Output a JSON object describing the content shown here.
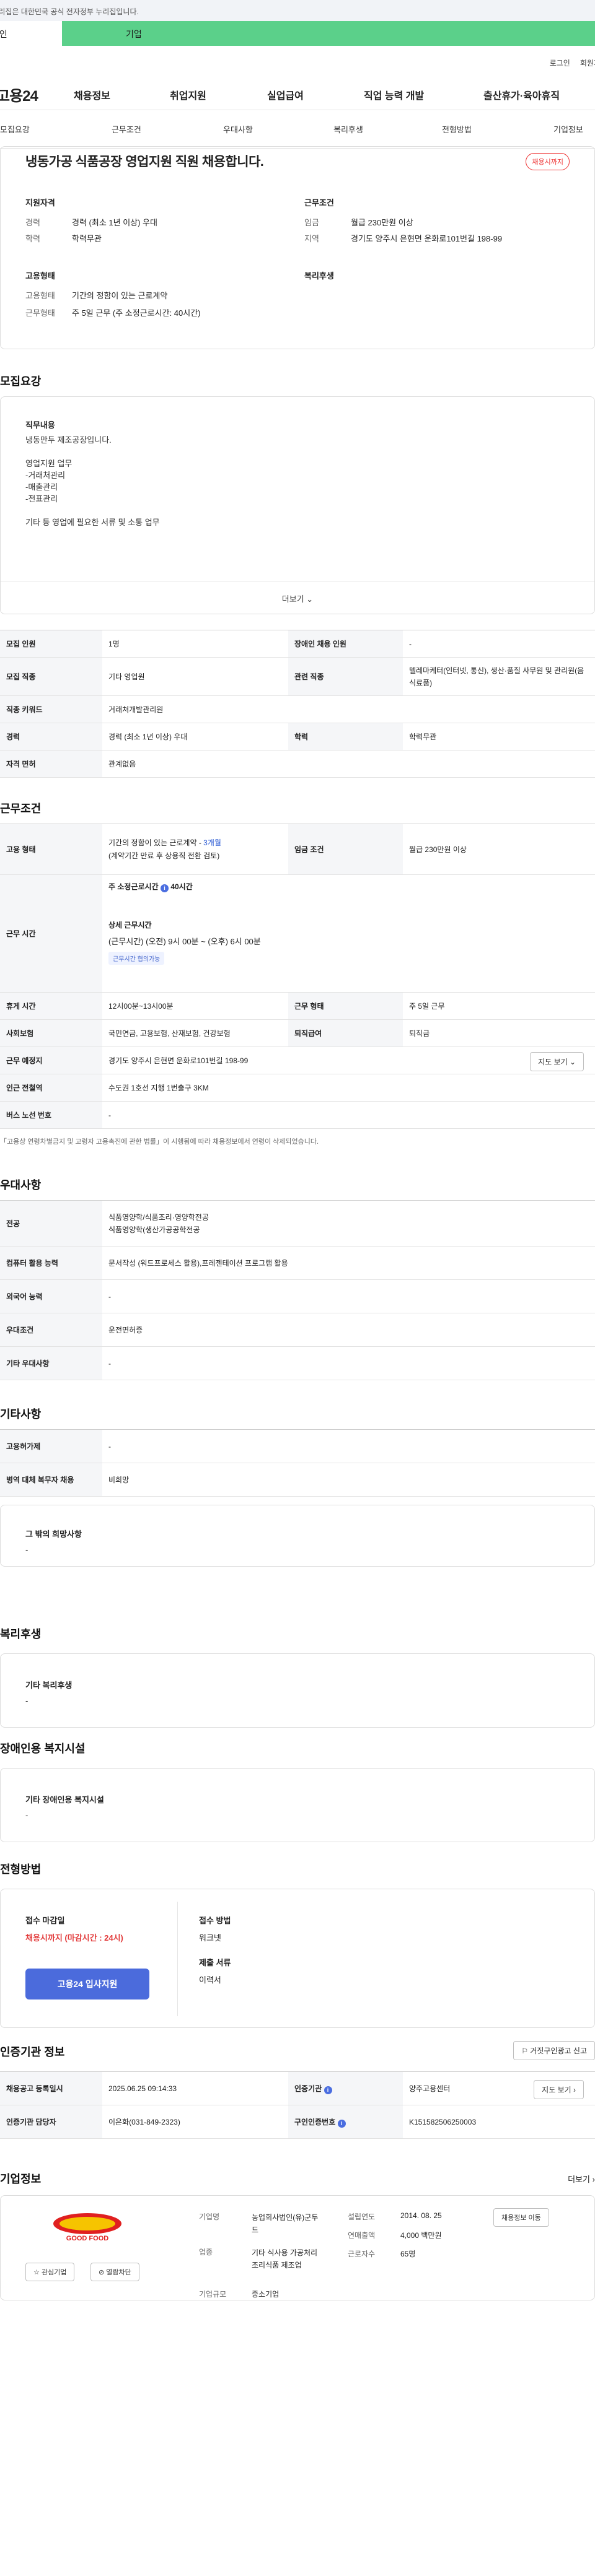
{
  "gov_bar": "이 누리집은 대한민국 공식 전자정부 누리집입니다.",
  "member_tabs": {
    "individual": "개인",
    "corporate": "기업"
  },
  "util": {
    "login": "로그인",
    "join": "회원가입"
  },
  "logo": "고용24",
  "gnb": [
    "채용정보",
    "취업지원",
    "실업급여",
    "직업 능력 개발",
    "출산휴가·육아휴직"
  ],
  "anchor_nav": [
    "모집요강",
    "근무조건",
    "우대사항",
    "복리후생",
    "전형방법",
    "기업정보"
  ],
  "summary": {
    "title": "냉동가공 식품공장 영업지원 직원 채용합니다.",
    "badge": "채용시까지",
    "qual": {
      "head": "지원자격",
      "career_k": "경력",
      "career_v": "경력 (최소 1년 이상) 우대",
      "edu_k": "학력",
      "edu_v": "학력무관"
    },
    "work": {
      "head": "근무조건",
      "wage_k": "임금",
      "wage_v": "월급 230만원 이상",
      "loc_k": "지역",
      "loc_v": "경기도 양주시 은현면 운화로101번길 198-99"
    },
    "employ": {
      "head": "고용형태",
      "type_k": "고용형태",
      "type_v": "기간의 정함이 있는 근로계약",
      "shape_k": "근무형태",
      "shape_v": "주 5일 근무 (주 소정근로시간: 40시간)"
    },
    "welfare": {
      "head": "복리후생"
    }
  },
  "recruit": {
    "title": "모집요강",
    "duty_head": "직무내용",
    "duty_text": "냉동만두 제조공장입니다.\n\n영업지원 업무\n-거래처관리\n-매출관리\n-전표관리\n\n기타 등 영업에 필요한 서류 및 소통 업무",
    "more": "더보기",
    "rows": {
      "headcount_k": "모집 인원",
      "headcount_v": "1명",
      "disabled_k": "장애인 채용 인원",
      "disabled_v": "-",
      "job_k": "모집 직종",
      "job_v": "기타 영업원",
      "rel_k": "관련 직종",
      "rel_v": "텔레마케터(인터넷, 통신), 생산·품질 사무원 및 관리원(음식료품)",
      "keyword_k": "직종 키워드",
      "keyword_v": "거래처개발관리원",
      "career_k": "경력",
      "career_v": "경력 (최소 1년 이상) 우대",
      "edu_k": "학력",
      "edu_v": "학력무관",
      "license_k": "자격 면허",
      "license_v": "관계없음"
    }
  },
  "conditions": {
    "title": "근무조건",
    "emp_k": "고용 형태",
    "emp_v1": "기간의 정함이 있는 근로계약 - ",
    "emp_months": "3개월",
    "emp_v2": "(계약기간 만료 후 상용직 전환 검토)",
    "wage_k": "임금 조건",
    "wage_v": "월급 230만원 이상",
    "hours_k": "근무 시간",
    "hours_week": "주 소정근로시간",
    "hours_week_v": "40시간",
    "hours_detail_head": "상세 근무시간",
    "hours_detail_v": "(근무시간) (오전) 9시 00분 ~ (오후) 6시 00분",
    "hours_pill": "근무시간 협의가능",
    "break_k": "휴게 시간",
    "break_v": "12시00분~13시00분",
    "shape_k": "근무 형태",
    "shape_v": "주 5일 근무",
    "ins_k": "사회보험",
    "ins_v": "국민연금, 고용보험, 산재보험, 건강보험",
    "sev_k": "퇴직급여",
    "sev_v": "퇴직금",
    "loc_k": "근무 예정지",
    "loc_v": "경기도 양주시 은현면 운화로101번길 198-99",
    "map_btn": "지도 보기",
    "subway_k": "인근 전철역",
    "subway_v": "수도권 1호선 지행 1번출구 3KM",
    "bus_k": "버스 노선 번호",
    "bus_v": "-",
    "note": "「고용상 연령차별금지 및 고령자 고용촉진에 관한 법률」이 시행됨에 따라 채용정보에서 연령이 삭제되었습니다."
  },
  "preferences": {
    "title": "우대사항",
    "major_k": "전공",
    "major_v1": "식품영양학/식품조리·영양학전공",
    "major_v2": "식품영양학(생산가공공학전공",
    "pc_k": "컴퓨터 활용 능력",
    "pc_v": "문서작성 (워드프로세스 활용),프레젠테이션 프로그램 활용",
    "lang_k": "외국어 능력",
    "lang_v": "-",
    "cond_k": "우대조건",
    "cond_v": "운전면허증",
    "etc_k": "기타 우대사항",
    "etc_v": "-"
  },
  "etc": {
    "title": "기타사항",
    "ins_k": "고용허가제",
    "ins_v": "-",
    "mil_k": "병역 대체 복무자 채용",
    "mil_v": "비희망",
    "wish_head": "그 밖의 희망사항",
    "wish_v": "-"
  },
  "welfare": {
    "title": "복리후생",
    "head": "기타 복리후생",
    "value": "-"
  },
  "disabled_facility": {
    "title": "장애인용 복지시설",
    "head": "기타 장애인용 복지시설",
    "value": "-"
  },
  "selection": {
    "title": "전형방법",
    "deadline_head": "접수 마감일",
    "deadline_v": "채용시까지 (마감시간 : 24시)",
    "apply_btn": "고용24 입사지원",
    "method_head": "접수 방법",
    "method_v": "워크넷",
    "docs_head": "제출 서류",
    "docs_v": "이력서"
  },
  "cert": {
    "title": "인증기관 정보",
    "report_btn": "거짓구인광고 신고",
    "reg_k": "채용공고 등록일시",
    "reg_v": "2025.06.25 09:14:33",
    "agency_k": "인증기관",
    "agency_v": "양주고용센터",
    "map_btn": "지도 보기",
    "mgr_k": "인증기관 담당자",
    "mgr_v": "이은화(031-849-2323)",
    "num_k": "구인인증번호",
    "num_v": "K151582506250003"
  },
  "company": {
    "title": "기업정보",
    "more": "더보기",
    "logo_text": "GOOD FOOD",
    "fav_btn": "관심기업",
    "block_btn": "열람차단",
    "name_k": "기업명",
    "name_v": "농업회사법인(유)군두드",
    "industry_k": "업종",
    "industry_v": "기타 식사용 가공처리 조리식품 제조업",
    "scale_k": "기업규모",
    "scale_v": "중소기업",
    "founded_k": "설립연도",
    "founded_v": "2014. 08. 25",
    "sales_k": "연매출액",
    "sales_v": "4,000 백만원",
    "emp_k": "근로자수",
    "emp_v": "65명",
    "jobs_btn": "채용정보 이동"
  },
  "colors": {
    "accent": "#4b6bdc",
    "corp_tab": "#5bd08a",
    "deadline": "#e23a3a"
  }
}
